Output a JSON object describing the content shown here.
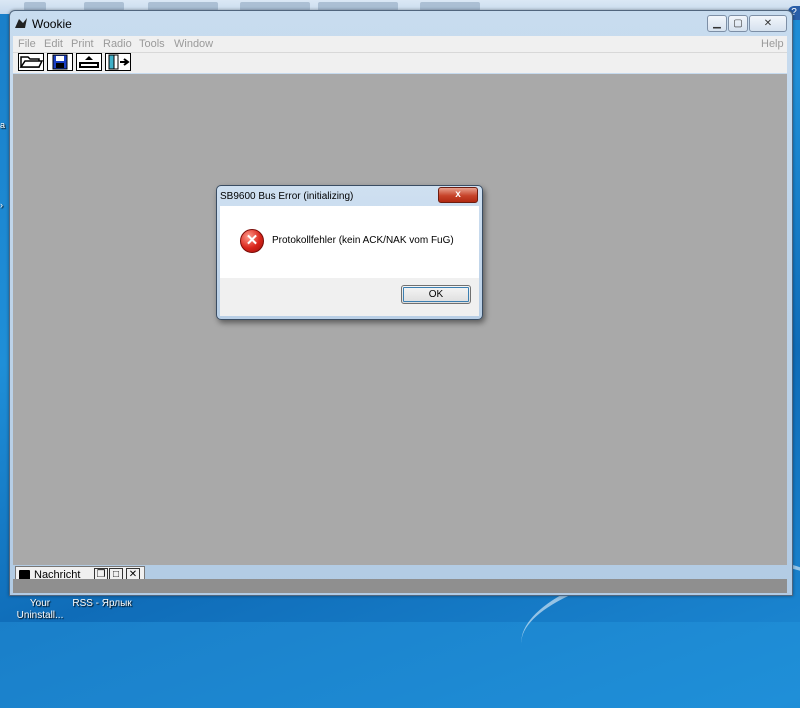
{
  "app": {
    "title": "Wookie",
    "menu": [
      "File",
      "Edit",
      "Print",
      "Radio",
      "Tools",
      "Window"
    ],
    "help_label": "Help",
    "toolbar": [
      {
        "icon": "open-folder-icon"
      },
      {
        "icon": "save-disk-icon"
      },
      {
        "icon": "radio-device-icon"
      },
      {
        "icon": "exit-door-icon"
      }
    ]
  },
  "minimized_window": {
    "title": "Nachricht"
  },
  "dialog": {
    "title": "SB9600 Bus Error (initializing)",
    "close_label": "x",
    "message": "Protokollfehler (kein ACK/NAK vom FuG)",
    "ok_label": "OK"
  },
  "desktop": {
    "icons": [
      "Your Uninstall...",
      "RSS - Ярлык"
    ]
  }
}
